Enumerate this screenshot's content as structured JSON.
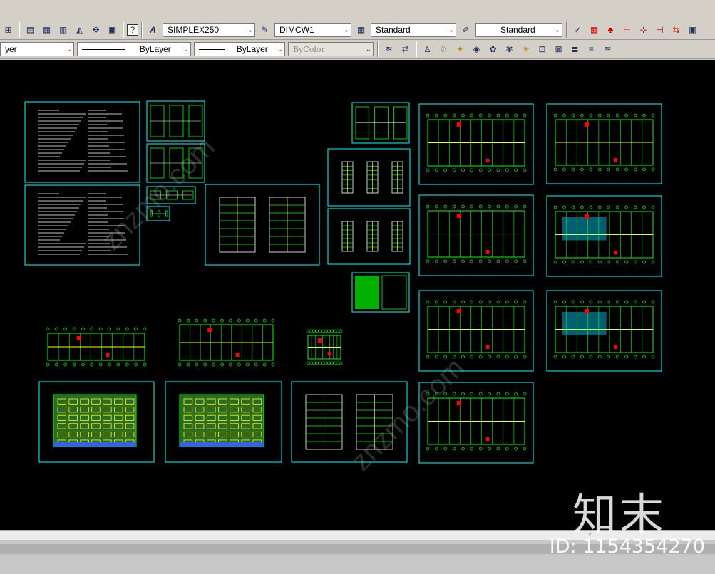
{
  "toolbar1": {
    "text_style": "SIMPLEX250",
    "dim_style": "DIMCW1",
    "table_style": "Standard",
    "multileader_style": "Standard"
  },
  "toolbar2": {
    "layer": "yer",
    "linetype": "ByLayer",
    "lineweight": "ByLayer",
    "plot_style": "ByColor"
  },
  "scrollbar": {
    "thumb": "‹"
  },
  "watermark": {
    "logo": "知末",
    "id": "ID: 1154354270",
    "diagonal": "znzmo.com"
  },
  "colors": {
    "canvas": "#000000",
    "frame": "#00ffff",
    "drawing": "#00ff00",
    "wall": "#ffff00",
    "accent": "#ff0000"
  }
}
